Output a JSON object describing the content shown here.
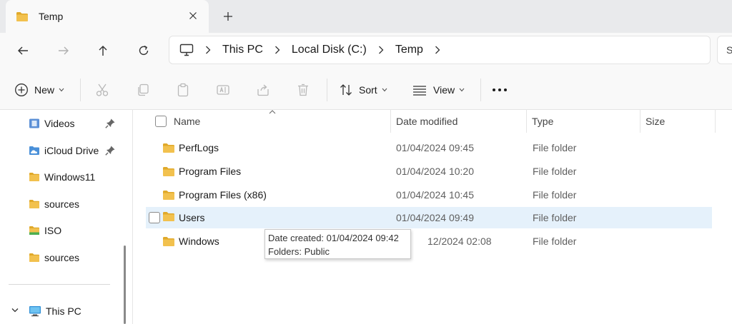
{
  "tab": {
    "title": "Temp"
  },
  "address": {
    "crumbs": [
      "This PC",
      "Local Disk (C:)",
      "Temp"
    ]
  },
  "search": {
    "partial_text": "S"
  },
  "toolbar": {
    "new_label": "New",
    "sort_label": "Sort",
    "view_label": "View"
  },
  "sidebar": {
    "items": [
      {
        "label": "Videos",
        "icon": "videos-folder-icon",
        "pinned": true
      },
      {
        "label": "iCloud Drive",
        "icon": "icloud-folder-icon",
        "pinned": true
      },
      {
        "label": "Windows11",
        "icon": "folder-icon",
        "pinned": false
      },
      {
        "label": "sources",
        "icon": "folder-icon",
        "pinned": false
      },
      {
        "label": "ISO",
        "icon": "iso-folder-icon",
        "pinned": false
      },
      {
        "label": "sources",
        "icon": "folder-icon",
        "pinned": false
      }
    ],
    "this_pc": "This PC"
  },
  "columns": {
    "name": "Name",
    "date": "Date modified",
    "type": "Type",
    "size": "Size"
  },
  "files": [
    {
      "name": "PerfLogs",
      "date": "01/04/2024 09:45",
      "type": "File folder"
    },
    {
      "name": "Program Files",
      "date": "01/04/2024 10:20",
      "type": "File folder"
    },
    {
      "name": "Program Files (x86)",
      "date": "01/04/2024 10:45",
      "type": "File folder"
    },
    {
      "name": "Users",
      "date": "01/04/2024 09:49",
      "type": "File folder"
    },
    {
      "name": "Windows",
      "date": "12/2024 02:08",
      "type": "File folder"
    }
  ],
  "tooltip": {
    "line1": "Date created: 01/04/2024 09:42",
    "line2": "Folders: Public"
  },
  "colors": {
    "folder": "#f2c14e",
    "folder_dark": "#e0a92a",
    "hover_row": "#e5f1fb",
    "accent": "#0067c0"
  }
}
